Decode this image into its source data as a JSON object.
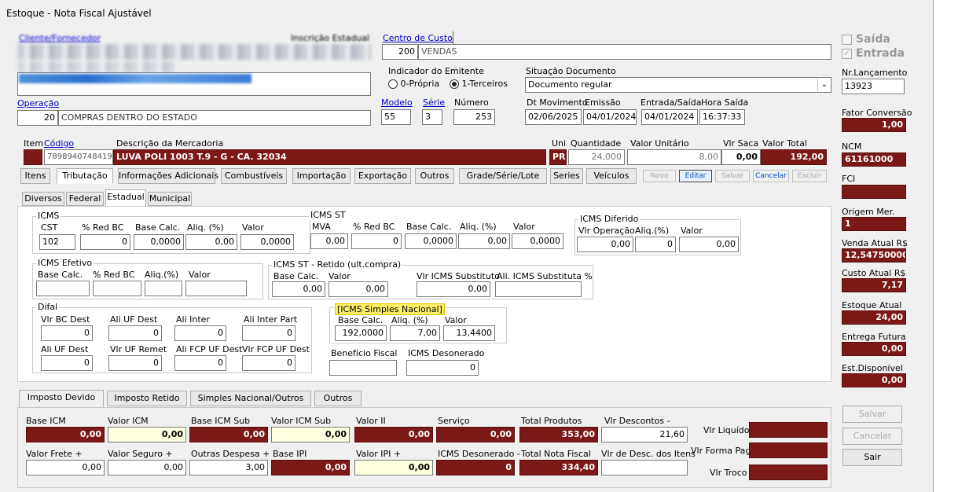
{
  "window": {
    "title": "Estoque - Nota Fiscal Ajustável"
  },
  "header": {
    "cliente_label": "Cliente/Fornecedor",
    "inscricao_label": "Inscrição Estadual",
    "centro_label": "Centro de Custo",
    "centro_code": "200",
    "centro_name": "VENDAS",
    "indicador_label": "Indicador do Emitente",
    "opt_propria": "0-Própria",
    "opt_terceiros": "1-Terceiros",
    "situacao_label": "Situação Documento",
    "situacao_value": "Documento regular",
    "operacao_label": "Operação",
    "operacao_code": "20",
    "operacao_name": "COMPRAS DENTRO DO ESTADO",
    "modelo_label": "Modelo",
    "modelo_value": "55",
    "serie_label": "Série",
    "serie_value": "3",
    "numero_label": "Número",
    "numero_value": "253",
    "dtmov_label": "Dt Movimento",
    "dtmov_value": "02/06/2025",
    "emissao_label": "Emissão",
    "emissao_value": "04/01/2024",
    "entsai_label": "Entrada/Saída",
    "entsai_value": "04/01/2024",
    "hora_label": "Hora Saída",
    "hora_value": "16:37:33"
  },
  "item": {
    "item_label": "Item",
    "codigo_label": "Código",
    "codigo_value": "7898940748419",
    "desc_label": "Descrição da Mercadoria",
    "desc_value": "LUVA POLI 1003 T.9 - G - CA. 32034",
    "uni_label": "Uni",
    "uni_value": "PR",
    "qtd_label": "Quantidade",
    "qtd_value": "24,000",
    "vunit_label": "Valor Unitário",
    "vunit_value": "8,00",
    "vsaca_label": "Vlr Saca",
    "vsaca_value": "0,00",
    "vtotal_label": "Valor Total",
    "vtotal_value": "192,00"
  },
  "tabs": [
    "Itens",
    "Tributação",
    "Informações Adicionais",
    "Combustíveis",
    "Importação",
    "Exportação",
    "Outros",
    "Grade/Série/Lote",
    "Series",
    "Veículos"
  ],
  "small_buttons": [
    "Novo",
    "Editar",
    "Salvar",
    "Cancelar",
    "Excluir"
  ],
  "subtabs": [
    "Diversos",
    "Federal",
    "Estadual",
    "Municipal"
  ],
  "icms": {
    "title": "ICMS",
    "cst_l": "CST",
    "cst_v": "102",
    "red_l": "% Red BC",
    "red_v": "0",
    "base_l": "Base Calc.",
    "base_v": "0,0000",
    "aliq_l": "Aliq. (%)",
    "aliq_v": "0,00",
    "valor_l": "Valor",
    "valor_v": "0,0000"
  },
  "icmsst": {
    "title": "ICMS ST",
    "mva_l": "MVA",
    "mva_v": "0,00",
    "red_l": "% Red BC",
    "red_v": "0",
    "base_l": "Base Calc.",
    "base_v": "0,0000",
    "aliq_l": "Aliq. (%)",
    "aliq_v": "0,00",
    "valor_l": "Valor",
    "valor_v": "0,0000"
  },
  "icmsdif": {
    "title": "ICMS Diferido",
    "op_l": "Vlr Operação",
    "op_v": "0,00",
    "aliq_l": "Aliq.(%)",
    "aliq_v": "0",
    "valor_l": "Valor",
    "valor_v": "0,00"
  },
  "icmsef": {
    "title": "ICMS Efetivo",
    "base_l": "Base Calc.",
    "red_l": "% Red BC",
    "aliq_l": "Aliq.(%)",
    "valor_l": "Valor"
  },
  "icmsstret": {
    "title": "ICMS ST - Retido (ult.compra)",
    "base_l": "Base Calc.",
    "base_v": "0,00",
    "valor_l": "Valor",
    "valor_v": "0,00",
    "sub_l": "Vlr ICMS Substituto",
    "sub_v": "0,00",
    "ali_l": "Ali. ICMS Substituta %"
  },
  "difal": {
    "title": "Difal",
    "bc_l": "Vlr BC Dest",
    "bc_v": "0",
    "aliuf_l": "Ali UF Dest",
    "aliuf_v": "0",
    "inter_l": "Ali Inter",
    "inter_v": "0",
    "interpart_l": "Ali Inter Part",
    "interpart_v": "0",
    "aliufd_l": "Ali UF Dest",
    "aliufd_v": "0",
    "remet_l": "Vlr UF Remet",
    "remet_v": "0",
    "fcp_l": "Ali FCP UF Dest",
    "fcp_v": "0",
    "vfcp_l": "Vlr FCP UF Dest",
    "vfcp_v": "0"
  },
  "simples": {
    "title": "[ICMS Simples Nacional]",
    "base_l": "Base Calc.",
    "base_v": "192,0000",
    "aliq_l": "Aliq. (%)",
    "aliq_v": "7,00",
    "valor_l": "Valor",
    "valor_v": "13,4400"
  },
  "beneficio_l": "Benefício Fiscal",
  "deson_l": "ICMS Desonerado",
  "deson_v": "0",
  "bottom_tabs": [
    "Imposto Devido",
    "Imposto Retido",
    "Simples Nacional/Outros",
    "Outros"
  ],
  "totals": {
    "baseicm_l": "Base ICM",
    "baseicm_v": "0,00",
    "valoricm_l": "Valor ICM",
    "valoricm_v": "0,00",
    "baseicmsub_l": "Base ICM Sub",
    "baseicmsub_v": "0,00",
    "valoricmsub_l": "Valor ICM Sub",
    "valoricmsub_v": "0,00",
    "valorii_l": "Valor II",
    "valorii_v": "0,00",
    "servico_l": "Serviço",
    "servico_v": "0,00",
    "totprod_l": "Total Produtos",
    "totprod_v": "353,00",
    "desc_l": "Vlr Descontos -",
    "desc_v": "21,60",
    "liq_l": "Vlr Liquído",
    "frete_l": "Valor Frete +",
    "frete_v": "0,00",
    "seguro_l": "Valor Seguro +",
    "seguro_v": "0,00",
    "outras_l": "Outras Despesa +",
    "outras_v": "3,00",
    "baseipi_l": "Base IPI",
    "baseipi_v": "0,00",
    "valoripi_l": "Valor IPI +",
    "valoripi_v": "0,00",
    "icmsdeson_l": "ICMS Desonerado -",
    "icmsdeson_v": "0",
    "totnota_l": "Total Nota Fiscal",
    "totnota_v": "334,40",
    "descitens_l": "Vlr de Desc. dos Itens",
    "formapag_l": "Vlr Forma Pag",
    "troco_l": "Vlr Troco"
  },
  "side": {
    "saida": "Saída",
    "entrada": "Entrada",
    "nrlanc_l": "Nr.Lançamento",
    "nrlanc_v": "13923",
    "fator_l": "Fator Conversão",
    "fator_v": "1,00",
    "ncm_l": "NCM",
    "ncm_v": "61161000",
    "fci_l": "FCI",
    "origem_l": "Origem Mer.",
    "origem_v": "1",
    "venda_l": "Venda Atual R$",
    "venda_v": "12,54750000",
    "custo_l": "Custo Atual R$",
    "custo_v": "7,17",
    "estoque_l": "Estoque Atual",
    "estoque_v": "24,00",
    "entrega_l": "Entrega Futura",
    "entrega_v": "0,00",
    "estdisp_l": "Est.Disponível",
    "estdisp_v": "0,00",
    "salvar": "Salvar",
    "cancelar": "Cancelar",
    "sair": "Sair"
  }
}
